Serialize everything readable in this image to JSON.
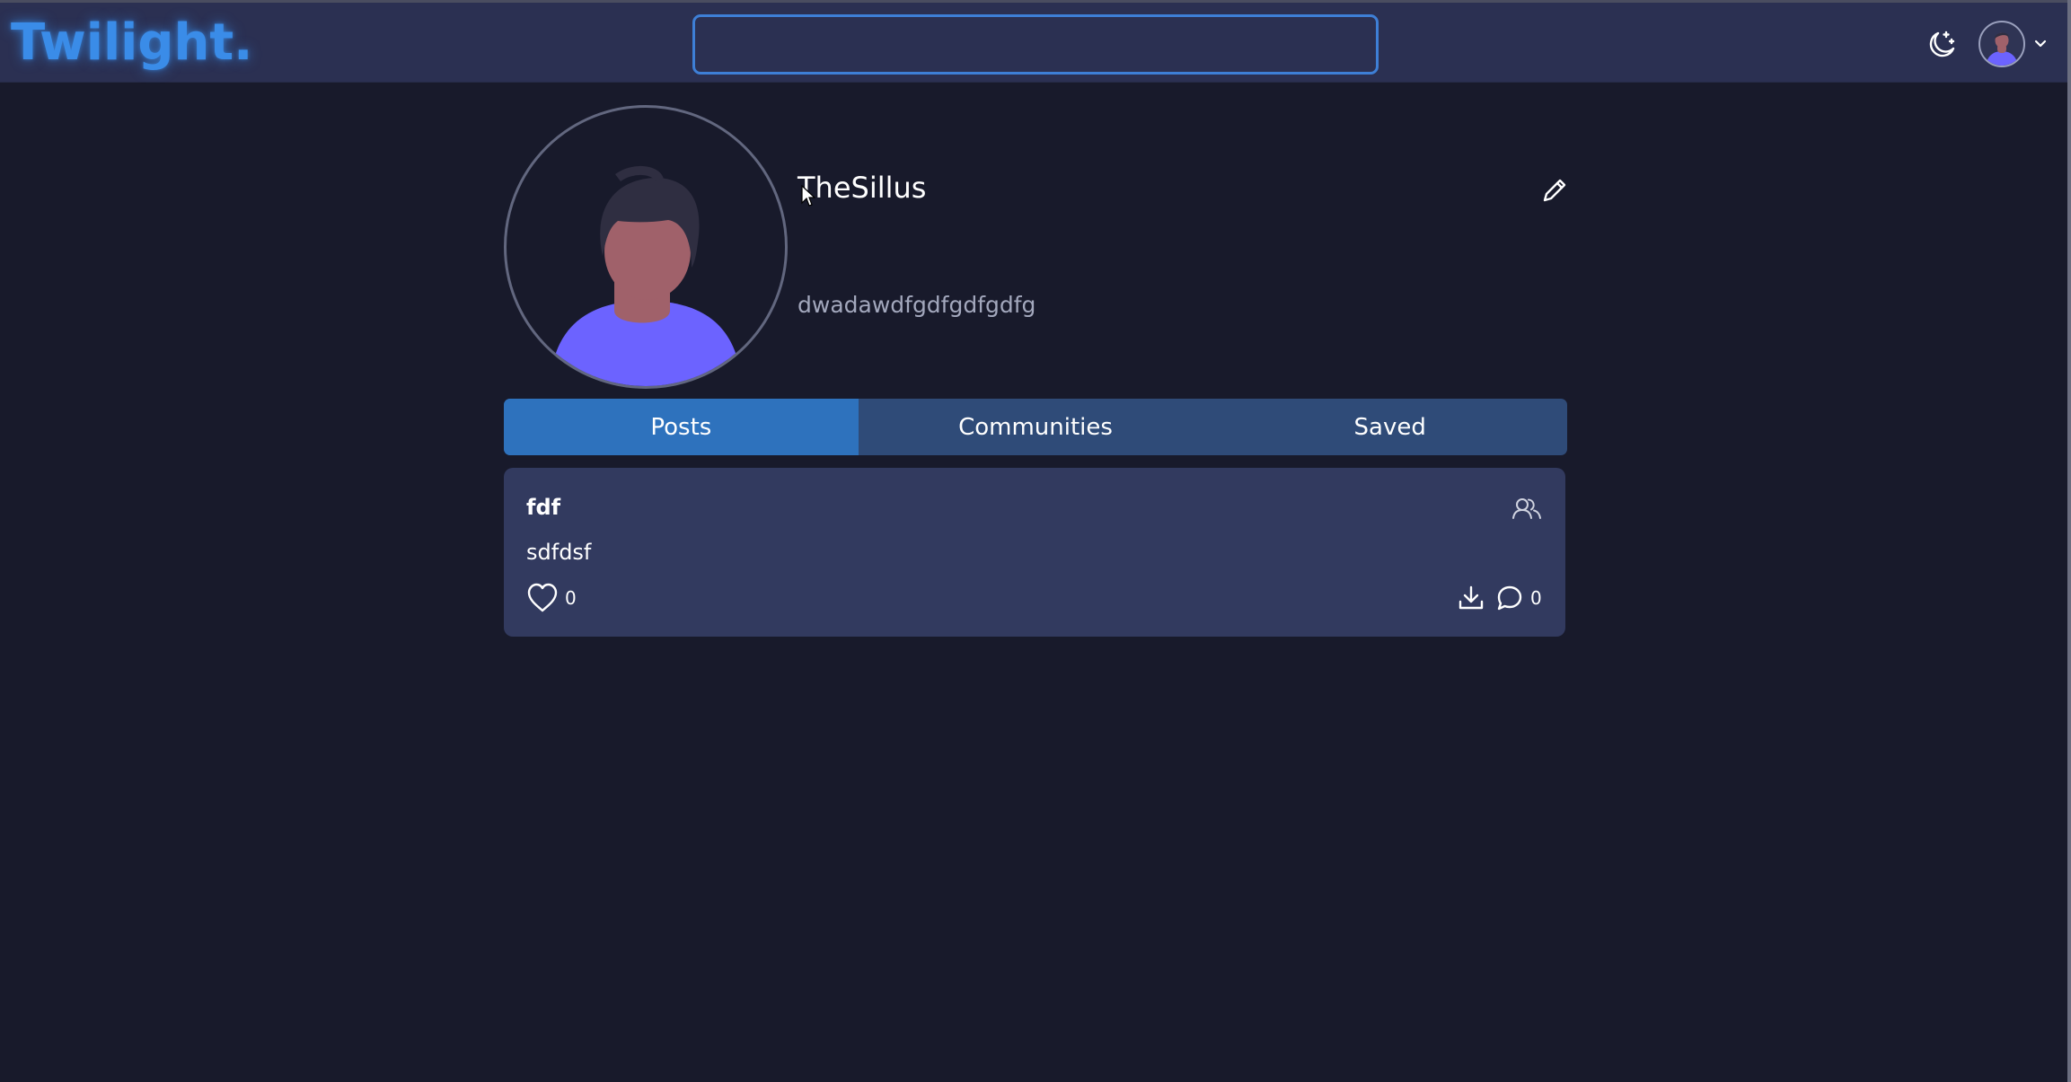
{
  "navbar": {
    "logo": "Twilight.",
    "search": {
      "value": "",
      "placeholder": ""
    },
    "theme_toggle_icon": "moon-stars-icon",
    "user_menu_icon": "avatar-icon"
  },
  "profile": {
    "username": "TheSillus",
    "bio": "dwadawdfgdfgdfgdfg",
    "edit_icon": "pencil-icon"
  },
  "tabs": [
    {
      "label": "Posts",
      "active": true
    },
    {
      "label": "Communities",
      "active": false
    },
    {
      "label": "Saved",
      "active": false
    }
  ],
  "posts": [
    {
      "title": "fdf",
      "body": "sdfdsf",
      "likes": "0",
      "comments": "0"
    }
  ],
  "colors": {
    "background": "#181a2b",
    "navbar": "#2b3052",
    "accent": "#3a8ce8",
    "tab_active": "#2e72bd",
    "tab_inactive": "#2f4b78",
    "card": "#323a5f",
    "avatar_shirt": "#6c63ff",
    "avatar_skin": "#a0616a"
  }
}
